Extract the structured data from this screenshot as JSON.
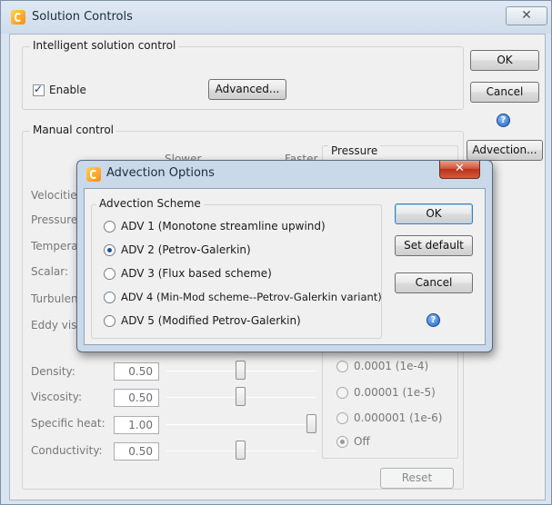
{
  "window": {
    "title": "Solution Controls",
    "close_glyph": "✕",
    "buttons": {
      "ok": "OK",
      "cancel": "Cancel",
      "advection": "Advection..."
    },
    "help_glyph": "?"
  },
  "intelligent": {
    "group_label": "Intelligent solution control",
    "enable_label": "Enable",
    "enable_checked": true,
    "advanced_button": "Advanced..."
  },
  "manual": {
    "group_label": "Manual control",
    "column_headers": {
      "slower": "Slower",
      "faster": "Faster",
      "pressure": "Pressure"
    },
    "row_labels_upper": [
      "Velocities:",
      "Pressure:",
      "Temperat",
      "Scalar:",
      "Turbulenc",
      "Eddy visc"
    ],
    "sliders": [
      {
        "label": "Density:",
        "value": "0.50",
        "position_fraction": 0.5
      },
      {
        "label": "Viscosity:",
        "value": "0.50",
        "position_fraction": 0.5
      },
      {
        "label": "Specific heat:",
        "value": "1.00",
        "position_fraction": 1.0
      },
      {
        "label": "Conductivity:",
        "value": "0.50",
        "position_fraction": 0.5
      }
    ],
    "convergence_options": [
      {
        "label": "0.0001 (1e-4)",
        "checked": false
      },
      {
        "label": "0.00001 (1e-5)",
        "checked": false
      },
      {
        "label": "0.000001 (1e-6)",
        "checked": false
      },
      {
        "label": "Off",
        "checked": true
      }
    ],
    "reset_button": "Reset"
  },
  "dialog": {
    "title": "Advection Options",
    "close_glyph": "✕",
    "group_label": "Advection Scheme",
    "options": [
      {
        "label": "ADV 1  (Monotone streamline upwind)",
        "checked": false
      },
      {
        "label": "ADV 2 (Petrov-Galerkin)",
        "checked": true
      },
      {
        "label": "ADV 3 (Flux based scheme)",
        "checked": false
      },
      {
        "label": "ADV 4 (Min-Mod scheme--Petrov-Galerkin variant)",
        "checked": false
      },
      {
        "label": "ADV 5 (Modified Petrov-Galerkin)",
        "checked": false
      }
    ],
    "buttons": {
      "ok": "OK",
      "set_default": "Set default",
      "cancel": "Cancel"
    },
    "help_glyph": "?"
  },
  "icons": {
    "app": "app-logo-icon",
    "help": "help-icon",
    "close": "close-icon"
  },
  "colors": {
    "accent_blue": "#3c7fb1",
    "close_red": "#c8402a",
    "window_frame": "#d8e4f0"
  }
}
